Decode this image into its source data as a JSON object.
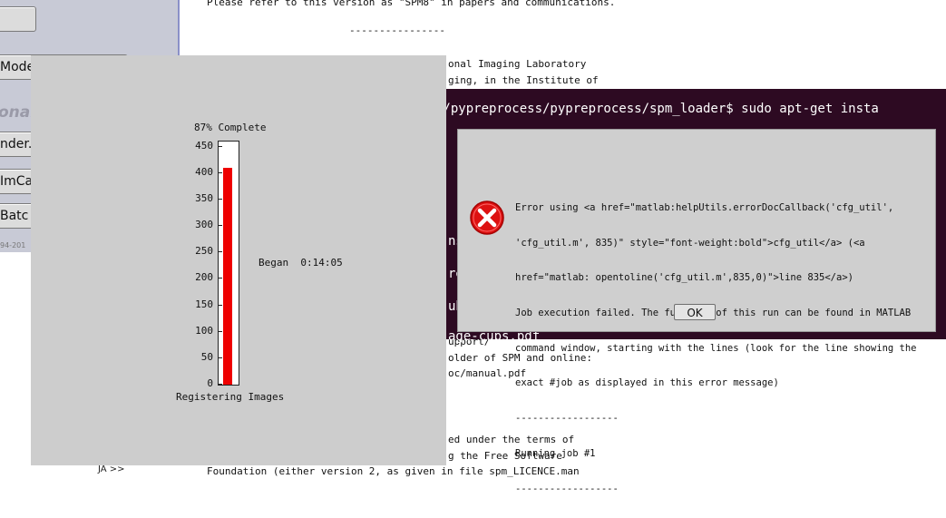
{
  "background_text": [
    "Please refer to this version as \"SPM8\" in papers and communications.",
    "----------------",
    "onal Imaging Laboratory",
    "ging, in the Institute of",
    "upport/",
    "older of SPM and online:",
    "oc/manual.pdf",
    "ed under the terms of",
    "g the Free Software",
    "Foundation (either version 2, as given in file spm_LICENCE.man"
  ],
  "spm_menu": {
    "buttons": [
      "Mode",
      "nder.",
      "ImCa",
      "Batc"
    ],
    "heading": "onal",
    "copyright": "94-201"
  },
  "terminal": {
    "prompt": "s/pypreprocess/pypreprocess/spm_loader$ sudo apt-get insta",
    "fragments": [
      "ns",
      "re",
      "ub",
      "age-cups.pdf"
    ]
  },
  "error_dialog": {
    "icon": "error-icon",
    "message_lines": [
      "Error using <a href=\"matlab:helpUtils.errorDocCallback('cfg_util',",
      "'cfg_util.m', 835)\" style=\"font-weight:bold\">cfg_util</a> (<a",
      "href=\"matlab: opentoline('cfg_util.m',835,0)\">line 835</a>)",
      "Job execution failed. The full log of this run can be found in MATLAB",
      "command window, starting with the lines (look for the line showing the",
      "exact #job as displayed in this error message)",
      "------------------",
      "Running job #1",
      "------------------"
    ],
    "ok_label": "OK",
    "colors": {
      "icon_red": "#dd1111"
    }
  },
  "progress": {
    "title": "87% Complete",
    "percent": 87,
    "value": 410,
    "ymax": 460,
    "yticks": [
      "450",
      "400",
      "350",
      "300",
      "250",
      "200",
      "150",
      "100",
      "50",
      "0"
    ],
    "began": "Began  0:14:05",
    "caption": "Registering Images",
    "colors": {
      "bar": "#ee0000"
    }
  },
  "bottom_widget": {
    "label": "JA >>"
  }
}
